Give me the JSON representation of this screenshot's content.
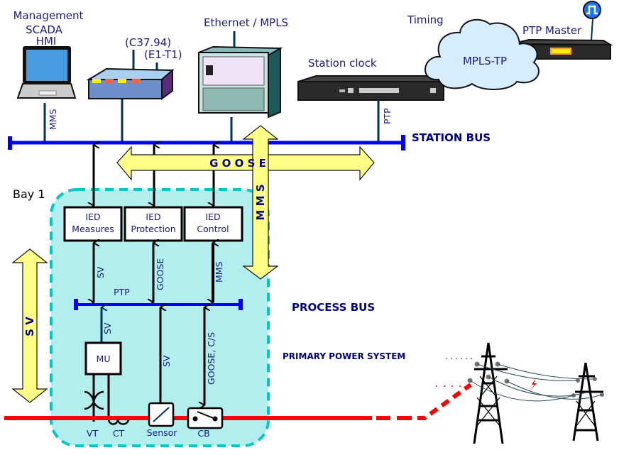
{
  "top": {
    "management_lines": [
      "Management",
      "SCADA",
      "HMI"
    ],
    "c3794": "(C37.94)",
    "e1t1": "(E1-T1)",
    "ethernet_mpls": "Ethernet / MPLS",
    "station_clock": "Station clock",
    "timing": "Timing",
    "mpls_tp": "MPLS-TP",
    "ptp_master": "PTP Master",
    "mms_link": "MMS",
    "ptp_link": "PTP"
  },
  "station_bus": {
    "label": "STATION BUS",
    "goose": "G O O S E",
    "mms": "M M S"
  },
  "bay": {
    "title": "Bay 1",
    "ieds": [
      {
        "line1": "IED",
        "line2": "Measures"
      },
      {
        "line1": "IED",
        "line2": "Protection"
      },
      {
        "line1": "IED",
        "line2": "Control"
      }
    ],
    "links": [
      "SV",
      "GOOSE",
      "MMS"
    ],
    "ptp": "PTP",
    "mu": "MU",
    "mu_link": "SV",
    "sensor_link": "SV",
    "cb_link": "GOOSE, C/S",
    "devices": [
      "VT",
      "CT",
      "Sensor",
      "CB"
    ]
  },
  "process_bus": {
    "label": "PROCESS BUS"
  },
  "primary": {
    "label": "PRIMARY POWER SYSTEM"
  },
  "sv_arrow": "S V",
  "colors": {
    "bus": "#0000ff",
    "bay_fill": "#b2eeee",
    "bay_border": "#00c8c8",
    "arrow_fill": "#ffff88",
    "power_line": "#ff0000",
    "text": "#000080"
  }
}
